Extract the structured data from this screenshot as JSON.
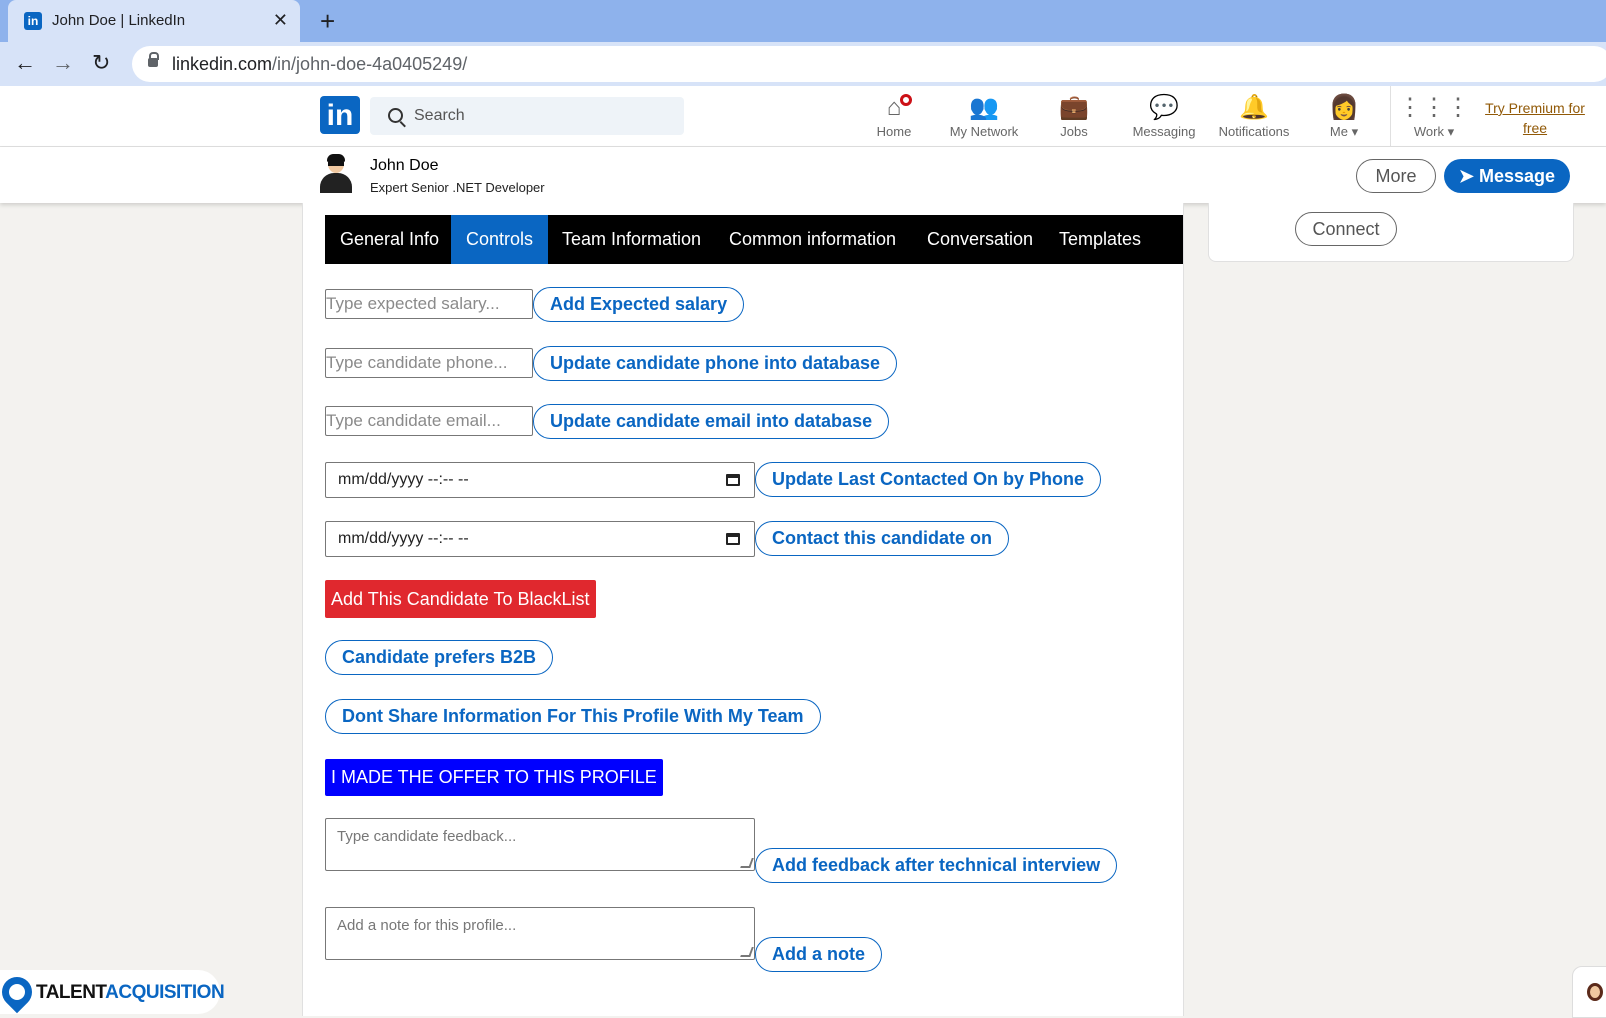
{
  "browser": {
    "tab_title": "John Doe | LinkedIn",
    "url_host": "linkedin.com",
    "url_path": "/in/john-doe-4a0405249/"
  },
  "header": {
    "logo": "in",
    "search_placeholder": "Search",
    "nav": [
      {
        "label": "Home",
        "icon": "home-icon"
      },
      {
        "label": "My Network",
        "icon": "network-icon"
      },
      {
        "label": "Jobs",
        "icon": "briefcase-icon"
      },
      {
        "label": "Messaging",
        "icon": "chat-icon"
      },
      {
        "label": "Notifications",
        "icon": "bell-icon"
      },
      {
        "label": "Me",
        "icon": "avatar-icon"
      },
      {
        "label": "Work",
        "icon": "grid-icon"
      }
    ],
    "premium": "Try Premium for free"
  },
  "profile": {
    "name": "John Doe",
    "headline": "Expert Senior .NET Developer",
    "more_label": "More",
    "message_label": "Message",
    "connect_label": "Connect"
  },
  "tabs": [
    "General Info",
    "Controls",
    "Team Information",
    "Common information",
    "Conversation",
    "Templates"
  ],
  "active_tab": "Controls",
  "controls": {
    "salary_placeholder": "Type expected salary...",
    "salary_button": "Add Expected salary",
    "phone_placeholder": "Type candidate phone...",
    "phone_button": "Update candidate phone into database",
    "email_placeholder": "Type candidate email...",
    "email_button": "Update candidate email into database",
    "date_placeholder": "mm/dd/yyyy --:-- --",
    "last_contacted_button": "Update Last Contacted On by Phone",
    "contact_on_button": "Contact this candidate on",
    "blacklist_button": "Add This Candidate To BlackList",
    "b2b_button": "Candidate prefers B2B",
    "dont_share_button": "Dont Share Information For This Profile With My Team",
    "offer_button": "I MADE THE OFFER TO THIS PROFILE",
    "feedback_placeholder": "Type candidate feedback...",
    "feedback_button": "Add feedback after technical interview",
    "note_placeholder": "Add a note for this profile...",
    "note_button": "Add a note"
  },
  "brand": {
    "part1": "TALENT",
    "part2": "ACQUISITION"
  },
  "colors": {
    "linkedin_blue": "#0a66c2",
    "blacklist_red": "#e0282e",
    "offer_blue": "#0000ff",
    "premium_gold": "#915907"
  }
}
